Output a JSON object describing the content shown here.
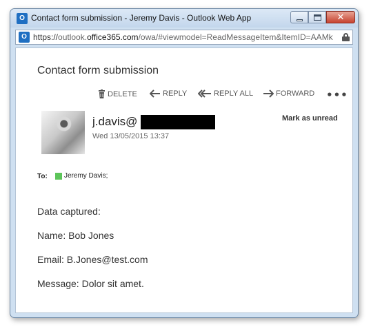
{
  "window": {
    "title": "Contact form submission - Jeremy Davis - Outlook Web App",
    "app_icon_letter": "O",
    "close_glyph": "✕"
  },
  "address_bar": {
    "scheme": "https://",
    "subdomain": "outlook.",
    "host": "office365.com",
    "path": "/owa/#viewmodel=ReadMessageItem&ItemID=AAMk"
  },
  "message": {
    "subject": "Contact form submission",
    "actions": {
      "delete": "DELETE",
      "reply": "REPLY",
      "reply_all": "REPLY ALL",
      "forward": "FORWARD",
      "more": "•••"
    },
    "sender_prefix": "j.davis@",
    "date": "Wed 13/05/2015 13:37",
    "mark_unread": "Mark as unread",
    "to_label": "To:",
    "recipient": "Jeremy Davis;",
    "body": [
      "Data captured:",
      "Name: Bob Jones",
      "Email: B.Jones@test.com",
      "Message: Dolor sit amet."
    ]
  },
  "colors": {
    "presence_available": "#5dc55a",
    "outlook_blue": "#1f6fc2",
    "close_red": "#c7432f"
  }
}
